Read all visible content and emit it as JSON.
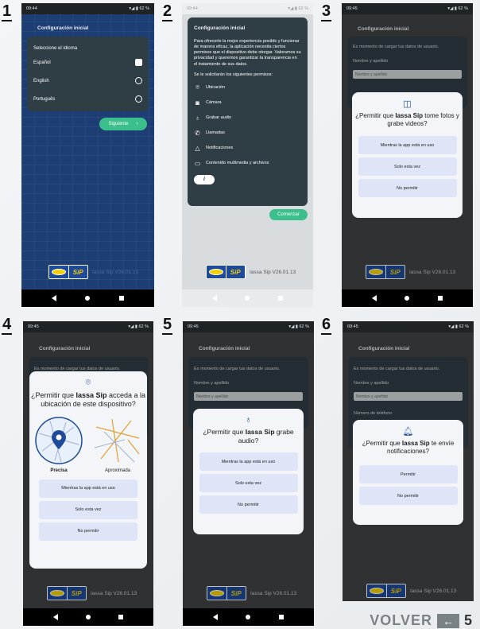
{
  "steps": [
    "1",
    "2",
    "3",
    "4",
    "5",
    "6"
  ],
  "status": {
    "time1": "09:44",
    "time2": "09:44",
    "time3": "09:45",
    "time4": "09:45",
    "time5": "09:45",
    "time6": "09:45",
    "signal": "62 %"
  },
  "app": {
    "title": "Configuración inicial",
    "version": "Iassa Sip V26.01.13",
    "logo_text": "SiP"
  },
  "screen1": {
    "subtitle": "Seleccione el idioma",
    "languages": [
      "Español",
      "English",
      "Português"
    ],
    "next_button": "Siguiente"
  },
  "screen2": {
    "intro": "Para ofrecerle la mejor experiencia posible y funcionar de manera eficaz, la aplicación necesita ciertos permisos que el dispositivo debe otorgar. Valoramos su privacidad y queremos garantizar la transparencia en el tratamiento de sus datos.",
    "perm_intro": "Se le solicitarán los siguientes permisos:",
    "permissions": [
      "Ubicación",
      "Cámara",
      "Grabar audio",
      "Llamadas",
      "Notificaciones",
      "Contenido multimedia y archivos"
    ],
    "info_button": "i",
    "start_button": "Comenzar"
  },
  "form": {
    "intro": "Es momento de cargar tus datos de usuario.",
    "name_label": "Nombre y apellido",
    "name_placeholder": "Nombre y apellido",
    "phone_label": "Número de teléfono"
  },
  "screen3": {
    "dialog_pre": "¿Permitir que ",
    "dialog_app": "Iassa Sip",
    "dialog_post": " tome fotos y grabe videos?",
    "buttons": [
      "Mientras la app está en uso",
      "Solo esta vez",
      "No permitir"
    ]
  },
  "screen4": {
    "dialog_pre": "¿Permitir que ",
    "dialog_app": "Iassa Sip",
    "dialog_post": " acceda a la ubicación de este dispositivo?",
    "precise": "Precisa",
    "approx": "Aproximada",
    "buttons": [
      "Mientras la app está en uso",
      "Solo esta vez",
      "No permitir"
    ]
  },
  "screen5": {
    "dialog_pre": "¿Permitir que ",
    "dialog_app": "Iassa Sip",
    "dialog_post": " grabe audio?",
    "buttons": [
      "Mientras la app está en uso",
      "Solo esta vez",
      "No permitir"
    ]
  },
  "screen6": {
    "dialog_pre": "¿Permitir que ",
    "dialog_app": "Iassa Sip",
    "dialog_post": " te envíe notificaciones?",
    "buttons": [
      "Permitir",
      "No permitir"
    ]
  },
  "footer": {
    "volver": "VOLVER",
    "page": "5"
  },
  "colors": {
    "accent": "#3bbf8c",
    "dialog_btn": "#dfe5f6",
    "brand": "#1f4a9a"
  }
}
